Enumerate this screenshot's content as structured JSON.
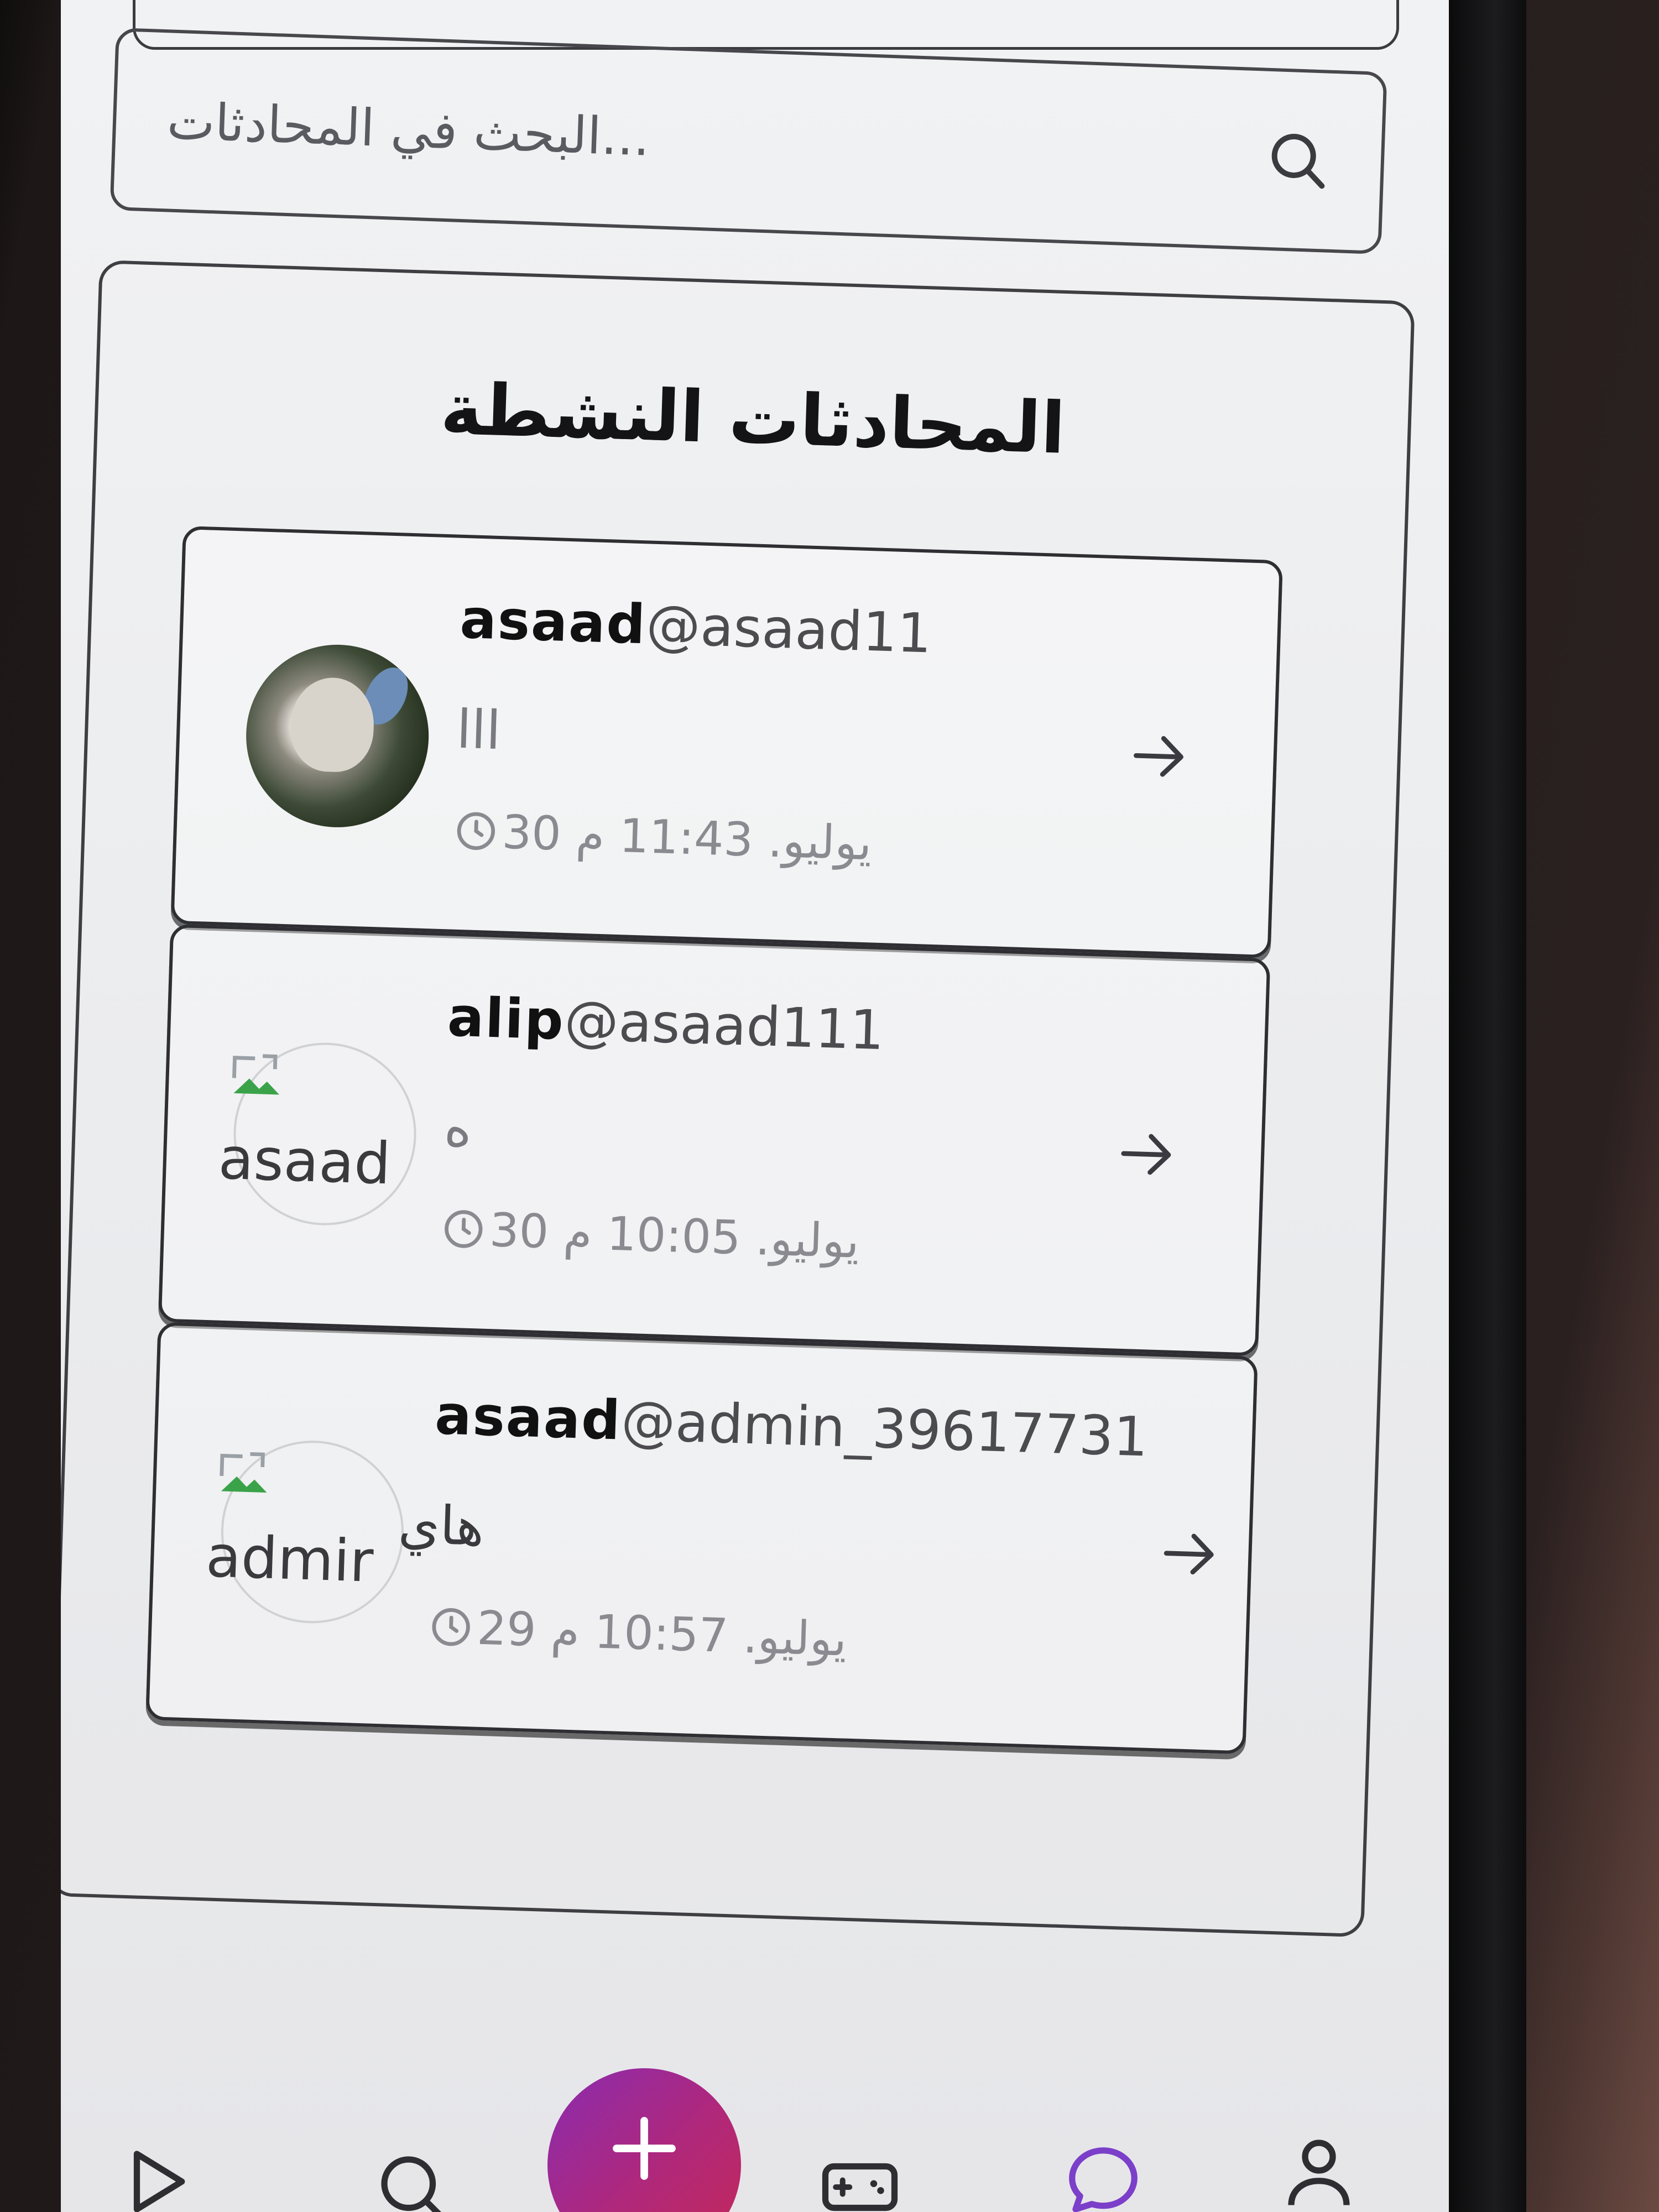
{
  "search": {
    "placeholder": "...البحث في المحادثات"
  },
  "panel": {
    "title": "المحادثات النشطة"
  },
  "conversations": [
    {
      "display_name": "asaad",
      "handle": "@asaad11",
      "last_message": "lll",
      "time": "يوليو. 11:43 م 30",
      "avatar": "photo",
      "avatar_alt": ""
    },
    {
      "display_name": "alip",
      "handle": "@asaad111",
      "last_message": "ه",
      "time": "يوليو. 10:05 م 30",
      "avatar": "broken-image",
      "avatar_alt": "asaad"
    },
    {
      "display_name": "asaad",
      "handle": "@admin_39617731",
      "last_message": "هاي",
      "time": "يوليو. 10:57 م 29",
      "avatar": "broken-image",
      "avatar_alt": "admir"
    }
  ],
  "bottom_nav": {
    "icons": [
      "play-icon",
      "search-icon",
      "plus-icon",
      "gamepad-icon",
      "chat-bubble-icon",
      "profile-icon"
    ]
  },
  "colors": {
    "fab_gradient_start": "#8a2bb0",
    "fab_gradient_end": "#c42757",
    "broken_icon_green": "#3aa34a",
    "chat_nav_active": "#7b3fc9"
  }
}
